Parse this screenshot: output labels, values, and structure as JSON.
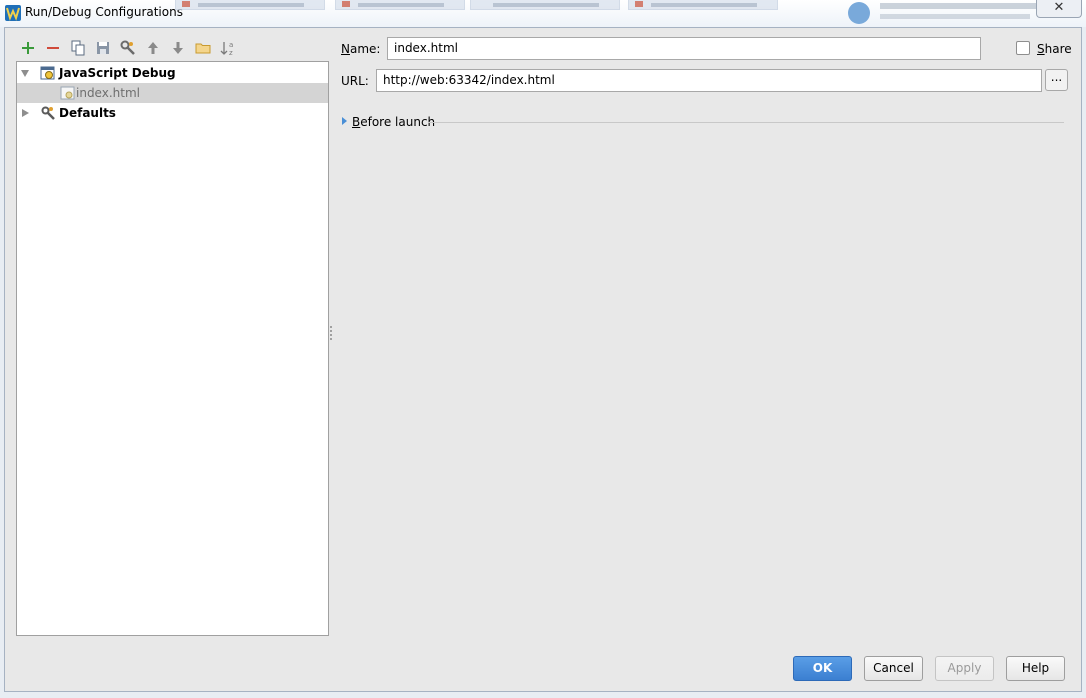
{
  "window": {
    "title": "Run/Debug Configurations",
    "close_glyph": "✕"
  },
  "toolbar": {
    "add": {
      "icon": "plus-icon",
      "glyph": "+",
      "color": "#3a9a3a"
    },
    "remove": {
      "icon": "minus-icon",
      "glyph": "−",
      "color": "#d04a3a"
    },
    "copy": {
      "icon": "copy-icon"
    },
    "save": {
      "icon": "save-icon"
    },
    "edit_defaults": {
      "icon": "wrench-icon"
    },
    "move_up": {
      "icon": "arrow-up-icon",
      "glyph": "🡑"
    },
    "move_down": {
      "icon": "arrow-down-icon",
      "glyph": "🡓"
    },
    "folder": {
      "icon": "folder-icon"
    },
    "sort": {
      "icon": "sort-alpha-icon"
    }
  },
  "tree": {
    "items": [
      {
        "label": "JavaScript Debug",
        "icon": "javascript-debug-icon",
        "expanded": true,
        "bold": true
      },
      {
        "label": "index.html",
        "icon": "config-icon",
        "selected": true
      },
      {
        "label": "Defaults",
        "icon": "wrench-icon",
        "expanded": false,
        "bold": true
      }
    ]
  },
  "form": {
    "name_label_prefix": "N",
    "name_label_rest": "ame:",
    "name_value": "index.html",
    "share_label_prefix": "S",
    "share_label_rest": "hare",
    "share_checked": false,
    "url_label": "URL:",
    "url_value": "http://web:63342/index.html",
    "browse_label": "...",
    "before_launch_prefix": "B",
    "before_launch_rest": "efore launch"
  },
  "buttons": {
    "ok": "OK",
    "cancel": "Cancel",
    "apply": "Apply",
    "help": "Help"
  },
  "colors": {
    "accent": "#3b7fd1",
    "expand_triangle": "#4a8fd6"
  }
}
